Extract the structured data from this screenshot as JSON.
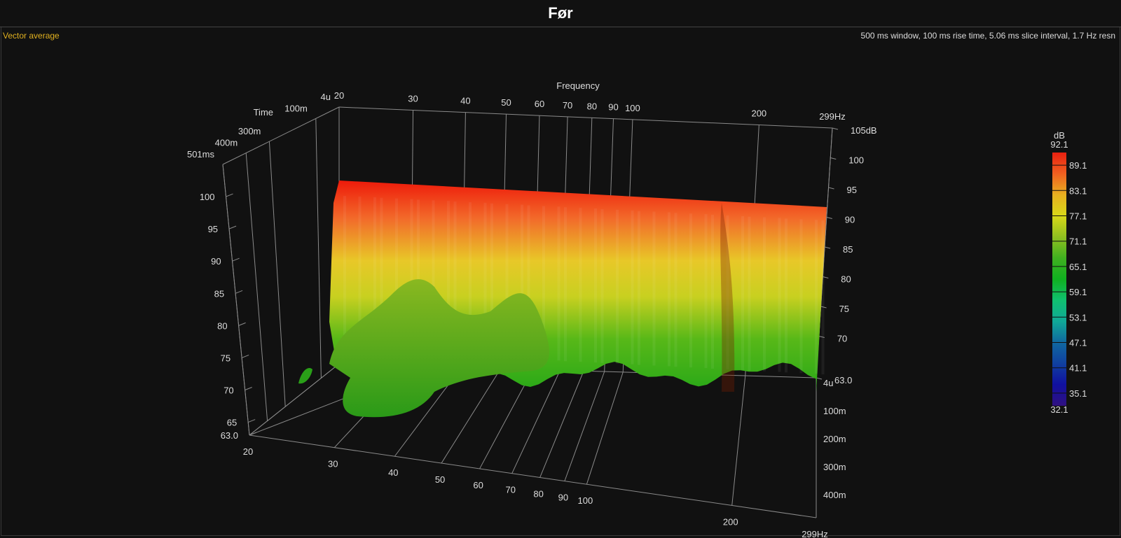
{
  "header": {
    "title": "Før"
  },
  "legend_label": "Vector average",
  "info_text": "500 ms window, 100 ms rise time, 5.06 ms slice interval, 1.7 Hz resn",
  "chart_data": {
    "type": "waterfall",
    "title": "Før",
    "x_axis": {
      "label": "Frequency",
      "ticks": [
        "20",
        "30",
        "40",
        "50",
        "60",
        "70",
        "80",
        "90",
        "100",
        "200",
        "299Hz"
      ],
      "values": [
        20,
        30,
        40,
        50,
        60,
        70,
        80,
        90,
        100,
        200,
        299
      ],
      "range": [
        20,
        299
      ],
      "scale": "log"
    },
    "time_axis": {
      "label": "Time",
      "ticks_back": [
        "4u",
        "100m",
        "300m",
        "400m",
        "501ms"
      ],
      "ticks_right": [
        "4u",
        "100m",
        "200m",
        "300m",
        "400m"
      ],
      "range_ms": [
        0,
        501
      ]
    },
    "z_axis": {
      "unit": "dB",
      "ticks_right": [
        "105dB",
        "100",
        "95",
        "90",
        "85",
        "80",
        "75",
        "70",
        "63.0"
      ],
      "ticks_left": [
        "100",
        "95",
        "90",
        "85",
        "80",
        "75",
        "70",
        "65",
        "63.0"
      ],
      "range": [
        63.0,
        105
      ]
    },
    "colorbar": {
      "label": "dB",
      "max": "92.1",
      "min": "32.1",
      "ticks": [
        "89.1",
        "83.1",
        "77.1",
        "71.1",
        "65.1",
        "59.1",
        "53.1",
        "47.1",
        "41.1",
        "35.1"
      ],
      "colors": [
        "#e82010",
        "#f06020",
        "#e8b020",
        "#d8d818",
        "#90c020",
        "#40b020",
        "#10b020",
        "#10c070",
        "#10a898",
        "#1068a0",
        "#1040a0",
        "#1010a0",
        "#301080"
      ]
    },
    "surface_description_colors": {
      "top": "#ee1a0a",
      "mid": "#e8d820",
      "base": "#30b018"
    }
  }
}
